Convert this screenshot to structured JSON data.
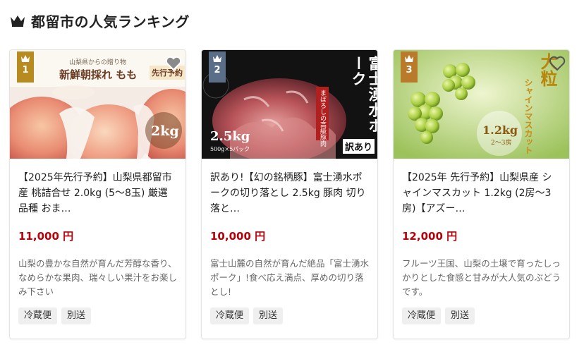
{
  "header": {
    "title": "都留市の人気ランキング",
    "icon": "crown-icon"
  },
  "cards": [
    {
      "rank": "1",
      "badge_color": "#b78b1f",
      "image": {
        "lines": [
          "山梨県からの贈り物",
          "新鮮朝採れ もも",
          "先行予約",
          "2kg"
        ]
      },
      "title": "【2025年先行予約】山梨県都留市産 桃詰合せ 2.0kg (5〜8玉) 厳選品種 おま…",
      "price": "11,000 円",
      "description": "山梨の豊かな自然が育んだ芳醇な香り、なめらかな果肉、瑞々しい果汁をお楽しみ下さい",
      "tags": [
        "冷蔵便",
        "別送"
      ]
    },
    {
      "rank": "2",
      "badge_color": "#5a6e88",
      "image": {
        "lines": [
          "富士湧水ポーク",
          "まぼろしの高級豚肉",
          "訳あり",
          "2.5kg",
          "500g×5パック"
        ]
      },
      "title": "訳あり!【幻の銘柄豚】富士湧水ポークの切り落とし 2.5kg 豚肉 切り落と…",
      "price": "10,000 円",
      "description": "富士山麓の自然が育んだ絶品「富士湧水ポーク」!食べ応え満点、厚めの切り落とし!",
      "tags": [
        "冷蔵便",
        "別送"
      ]
    },
    {
      "rank": "3",
      "badge_color": "#b97a2a",
      "image": {
        "lines": [
          "大粒",
          "シャインマスカット",
          "1.2kg",
          "2〜3房"
        ]
      },
      "title": "【2025年 先行予約】山梨県産 シャインマスカット 1.2kg (2房〜3房)【アズー…",
      "price": "12,000 円",
      "description": "フルーツ王国、山梨の土壌で育ったしっかりとした食感と甘みが大人気のぶどうです。",
      "tags": [
        "冷蔵便",
        "別送"
      ]
    }
  ]
}
